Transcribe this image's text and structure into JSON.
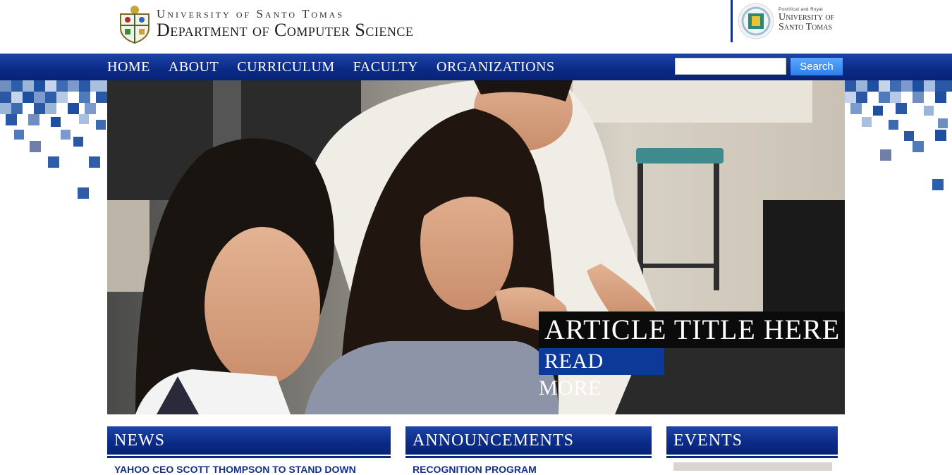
{
  "header": {
    "university_line": "University of Santo Tomas",
    "department_line": "Department of Computer Science",
    "right_logo_small": "Pontifical and Royal",
    "right_logo_line1": "University of",
    "right_logo_line2": "Santo Tomas"
  },
  "nav": {
    "items": [
      "HOME",
      "ABOUT",
      "CURRICULUM",
      "FACULTY",
      "ORGANIZATIONS"
    ]
  },
  "search": {
    "placeholder": "",
    "value": "",
    "button_label": "Search"
  },
  "hero": {
    "article_title": "ARTICLE TITLE HERE",
    "read_more_label": "READ MORE"
  },
  "sections": {
    "news": {
      "title": "NEWS",
      "first_item": "YAHOO CEO SCOTT THOMPSON TO STAND DOWN"
    },
    "announcements": {
      "title": "ANNOUNCEMENTS",
      "first_item": "RECOGNITION PROGRAM"
    },
    "events": {
      "title": "EVENTS"
    }
  },
  "colors": {
    "nav_blue": "#0b2a86",
    "accent_blue": "#0d3a99",
    "search_button": "#3d8ff0"
  },
  "icons": [
    "university-crest-icon",
    "ust-seal-icon"
  ]
}
